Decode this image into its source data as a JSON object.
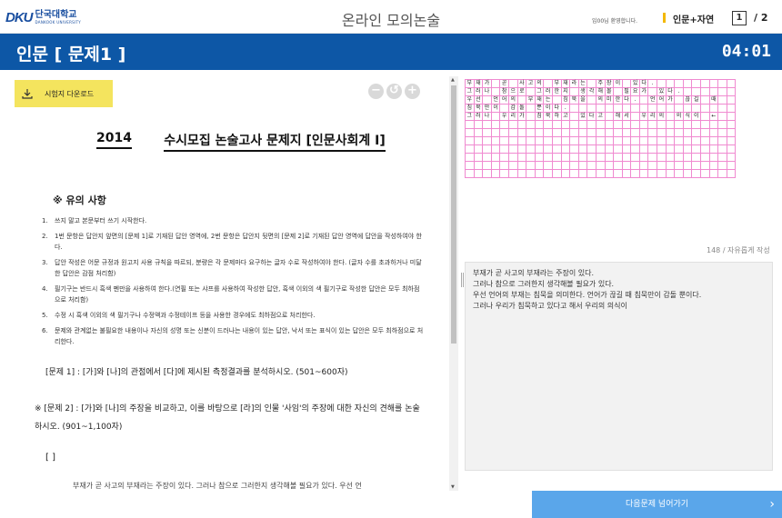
{
  "header": {
    "logo_mark": "DKU",
    "logo_kr": "단국대학교",
    "logo_en": "DANKOOK UNIVERSITY",
    "app_title": "온라인 모의논술",
    "welcome": "임00님 환영합니다.",
    "subject": "인문+자연",
    "current_page": "1",
    "total_pages": "/ 2"
  },
  "banner": {
    "question_title": "인문 [ 문제1 ]",
    "timer": "04:01"
  },
  "document": {
    "download_label": "시험지 다운로드",
    "zoom_out": "−",
    "zoom_reset": "↺",
    "zoom_in": "+",
    "year": "2014",
    "title": "수시모집 논술고사 문제지 [인문사회계 Ⅰ]",
    "notice_heading": "※ 유의 사항",
    "notices": [
      {
        "num": "1.",
        "text": "         쓰지 말고 본문부터 쓰기 시작한다."
      },
      {
        "num": "2.",
        "text": "1번 문항은 답안지 앞면의 [문제 1]로 기재된 답안 영역에, 2번 문항은 답안지 뒷면의 [문제 2]로 기재된 답안 영역에 답안을 작성하여야 한다."
      },
      {
        "num": "3.",
        "text": "답안 작성은 어문 규정과 원고지 사용 규칙을 따르되, 분량은 각 문제마다 요구하는 글자 수로 작성하여야 한다. (글자 수를 초과하거나 미달한 답안은 감점 처리함)"
      },
      {
        "num": "4.",
        "text": "필기구는 반드시 흑색 펜만을 사용하여 한다.(연필 또는 샤프를 사용하여 작성한 답안, 흑색 이외의 색 필기구로 작성한 답안은 모두 최하점으로 처리함)"
      },
      {
        "num": "5.",
        "text": "수정 시 흑색 이외의 색 필기구나 수정액과 수정테이프 등을 사용한 경우에도 최하점으로 처리한다."
      },
      {
        "num": "6.",
        "text": "문제와 관계없는 불필요한 내용이나 자신의 성명 또는 신분이 드러나는 내용이 있는 답안, 낙서 또는 표식이 있는 답안은 모두 최하점으로 처리한다."
      }
    ],
    "question1": "[문제 1] : [가]와 [나]의 관점에서 [다]에 제시된 측정결과를 분석하시오. (501~600자)",
    "question2": "※ [문제 2] : [가]와 [나]의 주장을 비교하고, 이를 바탕으로 [라]의 인물 '사임'의 주장에 대한 자신의 견해를 논술하시오. (901~1,100자)",
    "bracket": "[ ]",
    "answer_peek": "부재가 곧 사고의 부재라는 주장이 있다. 그러나 참으로 그러한지 생각해볼 필요가 있다. 우선 언"
  },
  "manuscript": {
    "rows": [
      "부재가 곧 사고의 부재라는 주장이 있다.",
      "그러나 참으로 그러한지 생각해볼 필요가 있다.",
      "우선 언어의 부재는 침묵을 의미한다. 언어가 끊길 때",
      "침묵만이 감돌 뿐이다.",
      "그러나 우리가 침묵하고 있다고 해서 우리의 의식이 ←"
    ]
  },
  "answer": {
    "char_count": "148 / 자유롭게 작성",
    "lines": [
      "부재가 곧 사고의 부재라는 주장이 있다.",
      "그러나 참으로 그러한지 생각해볼 필요가 있다.",
      "우선 언어의 부재는 침묵을 의미한다. 언어가 끊길 때  침묵만이 감돌 뿐이다.",
      "그러나 우리가 침묵하고 있다고 해서 우리의 의식이"
    ]
  },
  "footer": {
    "next_label": "다음문제 넘어가기",
    "next_icon": "chevron-right-icon"
  }
}
